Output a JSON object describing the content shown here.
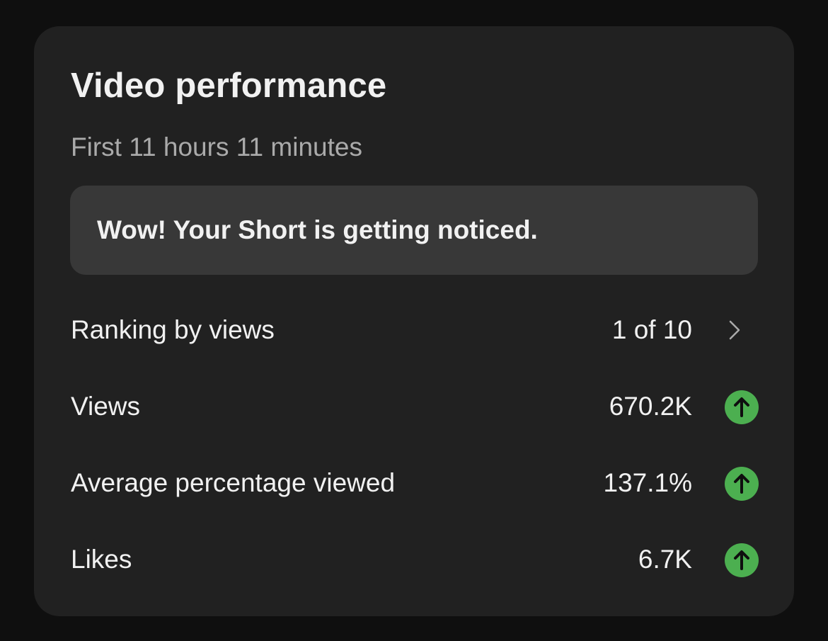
{
  "card": {
    "title": "Video performance",
    "subtitle": "First 11 hours 11 minutes",
    "banner": "Wow! Your Short is getting noticed."
  },
  "metrics": [
    {
      "label": "Ranking by views",
      "value": "1 of 10",
      "indicator": "chevron-right-icon"
    },
    {
      "label": "Views",
      "value": "670.2K",
      "indicator": "arrow-up-icon"
    },
    {
      "label": "Average percentage viewed",
      "value": "137.1%",
      "indicator": "arrow-up-icon"
    },
    {
      "label": "Likes",
      "value": "6.7K",
      "indicator": "arrow-up-icon"
    }
  ],
  "colors": {
    "background": "#0f0f0f",
    "card": "#212121",
    "banner": "#383838",
    "up_indicator": "#4caf50",
    "text_primary": "#f1f1f1",
    "text_secondary": "#aaaaaa"
  }
}
